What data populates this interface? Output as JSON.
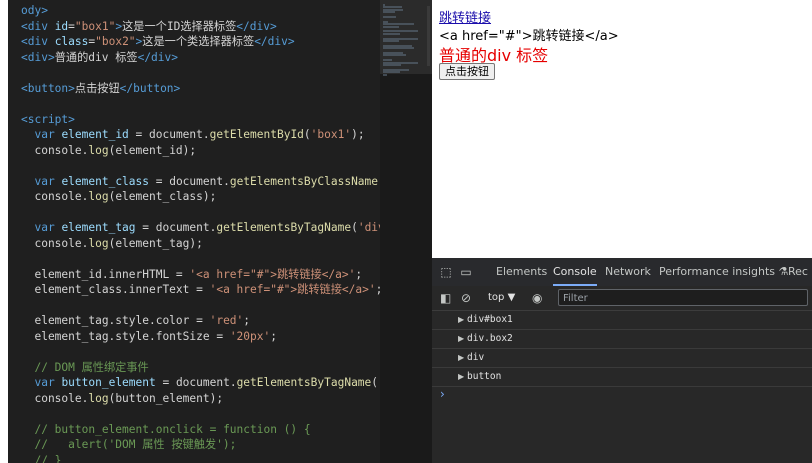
{
  "editor": {
    "lines": [
      [
        {
          "c": "tag",
          "t": "ody>"
        }
      ],
      [
        {
          "c": "tag",
          "t": "<div "
        },
        {
          "c": "attr",
          "t": "id"
        },
        {
          "c": "txt",
          "t": "="
        },
        {
          "c": "str",
          "t": "\"box1\""
        },
        {
          "c": "tag",
          "t": ">"
        },
        {
          "c": "txt",
          "t": "这是一个ID选择器标签"
        },
        {
          "c": "tag",
          "t": "</div>"
        }
      ],
      [
        {
          "c": "tag",
          "t": "<div "
        },
        {
          "c": "attr",
          "t": "class"
        },
        {
          "c": "txt",
          "t": "="
        },
        {
          "c": "str",
          "t": "\"box2\""
        },
        {
          "c": "tag",
          "t": ">"
        },
        {
          "c": "txt",
          "t": "这是一个类选择器标签"
        },
        {
          "c": "tag",
          "t": "</div>"
        }
      ],
      [
        {
          "c": "tag",
          "t": "<div>"
        },
        {
          "c": "txt",
          "t": "普通的div 标签"
        },
        {
          "c": "tag",
          "t": "</div>"
        }
      ],
      [],
      [
        {
          "c": "tag",
          "t": "<button>"
        },
        {
          "c": "txt",
          "t": "点击按钮"
        },
        {
          "c": "tag",
          "t": "</button>"
        }
      ],
      [],
      [
        {
          "c": "tag",
          "t": "<script>"
        }
      ],
      [
        {
          "c": "txt",
          "t": "  "
        },
        {
          "c": "kw",
          "t": "var "
        },
        {
          "c": "var",
          "t": "element_id"
        },
        {
          "c": "txt",
          "t": " = document."
        },
        {
          "c": "fn",
          "t": "getElementById"
        },
        {
          "c": "txt",
          "t": "("
        },
        {
          "c": "str",
          "t": "'box1'"
        },
        {
          "c": "txt",
          "t": ");"
        }
      ],
      [
        {
          "c": "txt",
          "t": "  console."
        },
        {
          "c": "fn",
          "t": "log"
        },
        {
          "c": "txt",
          "t": "(element_id);"
        }
      ],
      [],
      [
        {
          "c": "txt",
          "t": "  "
        },
        {
          "c": "kw",
          "t": "var "
        },
        {
          "c": "var",
          "t": "element_class"
        },
        {
          "c": "txt",
          "t": " = document."
        },
        {
          "c": "fn",
          "t": "getElementsByClassName"
        },
        {
          "c": "txt",
          "t": "("
        },
        {
          "c": "str",
          "t": "'box"
        }
      ],
      [
        {
          "c": "txt",
          "t": "  console."
        },
        {
          "c": "fn",
          "t": "log"
        },
        {
          "c": "txt",
          "t": "(element_class);"
        }
      ],
      [],
      [
        {
          "c": "txt",
          "t": "  "
        },
        {
          "c": "kw",
          "t": "var "
        },
        {
          "c": "var",
          "t": "element_tag"
        },
        {
          "c": "txt",
          "t": " = document."
        },
        {
          "c": "fn",
          "t": "getElementsByTagName"
        },
        {
          "c": "txt",
          "t": "("
        },
        {
          "c": "str",
          "t": "'div'"
        },
        {
          "c": "txt",
          "t": ")[2"
        }
      ],
      [
        {
          "c": "txt",
          "t": "  console."
        },
        {
          "c": "fn",
          "t": "log"
        },
        {
          "c": "txt",
          "t": "(element_tag);"
        }
      ],
      [],
      [
        {
          "c": "txt",
          "t": "  element_id.innerHTML = "
        },
        {
          "c": "str",
          "t": "'<a href=\"#\">跳转链接</a>'"
        },
        {
          "c": "txt",
          "t": ";"
        }
      ],
      [
        {
          "c": "txt",
          "t": "  element_class.innerText = "
        },
        {
          "c": "str",
          "t": "'<a href=\"#\">跳转链接</a>'"
        },
        {
          "c": "txt",
          "t": ";"
        }
      ],
      [],
      [
        {
          "c": "txt",
          "t": "  element_tag.style.color = "
        },
        {
          "c": "str",
          "t": "'red'"
        },
        {
          "c": "txt",
          "t": ";"
        }
      ],
      [
        {
          "c": "txt",
          "t": "  element_tag.style.fontSize = "
        },
        {
          "c": "str",
          "t": "'20px'"
        },
        {
          "c": "txt",
          "t": ";"
        }
      ],
      [],
      [
        {
          "c": "cm",
          "t": "  // DOM 属性绑定事件"
        }
      ],
      [
        {
          "c": "txt",
          "t": "  "
        },
        {
          "c": "kw",
          "t": "var "
        },
        {
          "c": "var",
          "t": "button_element"
        },
        {
          "c": "txt",
          "t": " = document."
        },
        {
          "c": "fn",
          "t": "getElementsByTagName"
        },
        {
          "c": "txt",
          "t": "("
        },
        {
          "c": "str",
          "t": "'butt"
        }
      ],
      [
        {
          "c": "txt",
          "t": "  console."
        },
        {
          "c": "fn",
          "t": "log"
        },
        {
          "c": "txt",
          "t": "(button_element);"
        }
      ],
      [],
      [
        {
          "c": "cm",
          "t": "  // button_element.onclick = function () {"
        }
      ],
      [
        {
          "c": "cm",
          "t": "  //   alert('DOM 属性 按键触发');"
        }
      ],
      [
        {
          "c": "cm",
          "t": "  // }"
        }
      ]
    ]
  },
  "page": {
    "link_text": "跳转链接",
    "plain_text": "<a href=\"#\">跳转链接</a>",
    "red_text": "普通的div 标签",
    "button_label": "点击按钮",
    "red_color": "#e60000"
  },
  "devtools": {
    "tabs": [
      {
        "label": "Elements",
        "active": false
      },
      {
        "label": "Console",
        "active": true
      },
      {
        "label": "Network",
        "active": false
      },
      {
        "label": "Performance insights ⚗",
        "active": false
      },
      {
        "label": "Rec",
        "active": false
      }
    ],
    "context": "top ▼",
    "filter_placeholder": "Filter",
    "console_rows": [
      "div#box1",
      "div.box2",
      "div",
      "button"
    ],
    "prompt": "›"
  }
}
